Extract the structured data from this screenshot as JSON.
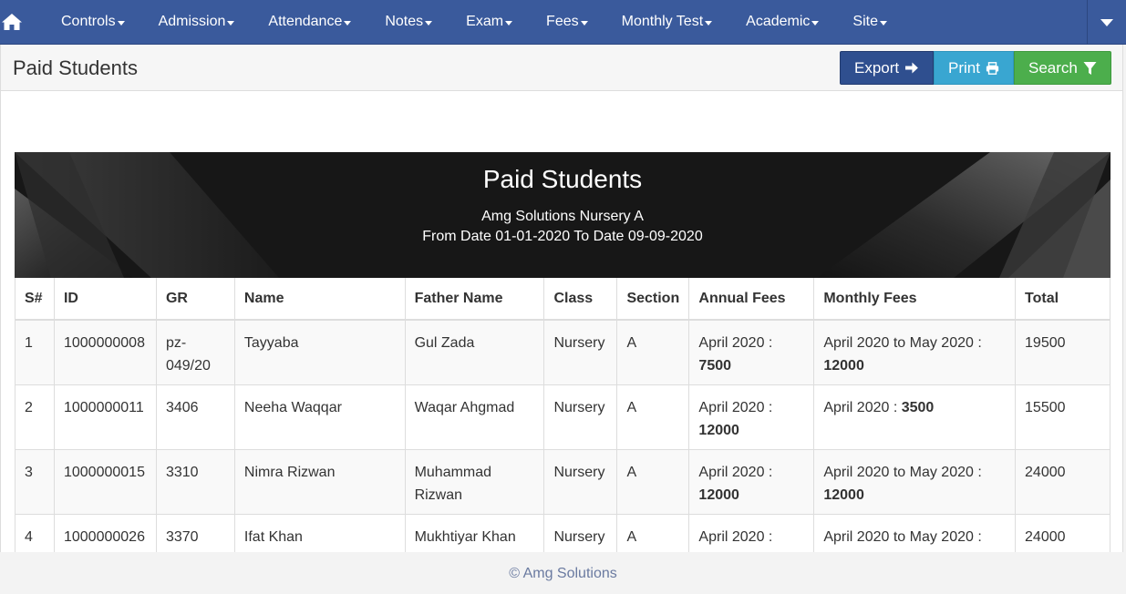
{
  "nav": {
    "items": [
      {
        "label": "Controls"
      },
      {
        "label": "Admission"
      },
      {
        "label": "Attendance"
      },
      {
        "label": "Notes"
      },
      {
        "label": "Exam"
      },
      {
        "label": "Fees"
      },
      {
        "label": "Monthly Test"
      },
      {
        "label": "Academic"
      },
      {
        "label": "Site"
      }
    ]
  },
  "page": {
    "title": "Paid Students",
    "export_label": "Export",
    "print_label": "Print",
    "search_label": "Search"
  },
  "report": {
    "title": "Paid Students",
    "school": "Amg Solutions Nursery A",
    "range": "From Date 01-01-2020 To Date 09-09-2020"
  },
  "table": {
    "headers": [
      "S#",
      "ID",
      "GR",
      "Name",
      "Father Name",
      "Class",
      "Section",
      "Annual Fees",
      "Monthly Fees",
      "Total"
    ],
    "rows": [
      {
        "sn": "1",
        "id": "1000000008",
        "gr": "pz-049/20",
        "name": "Tayyaba",
        "father": "Gul Zada",
        "class": "Nursery",
        "section": "A",
        "annual_period": "April 2020 :",
        "annual_amount": "7500",
        "monthly_period": "April 2020 to May 2020 :",
        "monthly_amount": "12000",
        "total": "19500"
      },
      {
        "sn": "2",
        "id": "1000000011",
        "gr": "3406",
        "name": "Neeha Waqqar",
        "father": "Waqar Ahgmad",
        "class": "Nursery",
        "section": "A",
        "annual_period": "April 2020 :",
        "annual_amount": "12000",
        "monthly_period": "April 2020 :",
        "monthly_amount": "3500",
        "total": "15500"
      },
      {
        "sn": "3",
        "id": "1000000015",
        "gr": "3310",
        "name": "Nimra Rizwan",
        "father": "Muhammad Rizwan",
        "class": "Nursery",
        "section": "A",
        "annual_period": "April 2020 :",
        "annual_amount": "12000",
        "monthly_period": "April 2020 to May 2020 :",
        "monthly_amount": "12000",
        "total": "24000"
      },
      {
        "sn": "4",
        "id": "1000000026",
        "gr": "3370",
        "name": "Ifat Khan",
        "father": "Mukhtiyar Khan",
        "class": "Nursery",
        "section": "A",
        "annual_period": "April 2020 :",
        "annual_amount": "",
        "monthly_period": "April 2020 to May 2020 :",
        "monthly_amount": "",
        "total": "24000"
      }
    ]
  },
  "footer": {
    "text": "© Amg Solutions"
  },
  "colors": {
    "navbar": "#3a5a9c",
    "export": "#2f4f8f",
    "print": "#39a6d1",
    "search": "#4cae4c"
  }
}
